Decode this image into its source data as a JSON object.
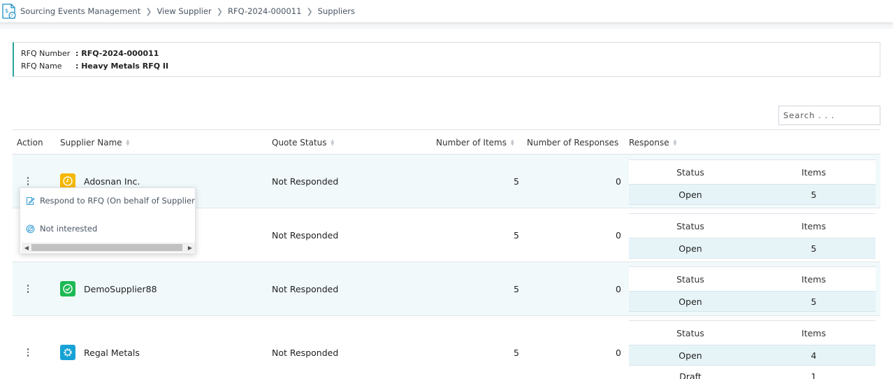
{
  "breadcrumb": [
    {
      "label": "Sourcing Events Management"
    },
    {
      "label": "View Supplier"
    },
    {
      "label": "RFQ-2024-000011"
    },
    {
      "label": "Suppliers"
    }
  ],
  "rfq": {
    "number_label": "RFQ Number",
    "number_value": ": RFQ-2024-000011",
    "name_label": "RFQ Name",
    "name_value": ": Heavy Metals RFQ II"
  },
  "search": {
    "placeholder": "Search . . ."
  },
  "table": {
    "headers": {
      "action": "Action",
      "supplier": "Supplier Name",
      "quote": "Quote Status",
      "items": "Number of Items",
      "responses": "Number of Responses",
      "response": "Response"
    },
    "resp_headers": {
      "status": "Status",
      "items": "Items"
    },
    "rows": [
      {
        "supplier": "Adosnan Inc.",
        "icon": "clock-icon",
        "icon_color": "#f5b800",
        "quote": "Not Responded",
        "items": "5",
        "responses": "0",
        "resp": [
          {
            "status": "Open",
            "items": "5"
          }
        ]
      },
      {
        "supplier": "",
        "icon": "check-icon",
        "icon_color": "#1db954",
        "quote": "Not Responded",
        "items": "5",
        "responses": "0",
        "resp": [
          {
            "status": "Open",
            "items": "5"
          }
        ]
      },
      {
        "supplier": "DemoSupplier88",
        "icon": "check-icon",
        "icon_color": "#1db954",
        "quote": "Not Responded",
        "items": "5",
        "responses": "0",
        "resp": [
          {
            "status": "Open",
            "items": "5"
          }
        ]
      },
      {
        "supplier": "Regal Metals",
        "icon": "gear-icon",
        "icon_color": "#17a2d6",
        "quote": "Not Responded",
        "items": "5",
        "responses": "0",
        "resp": [
          {
            "status": "Open",
            "items": "4"
          },
          {
            "status": "Draft",
            "items": "1"
          }
        ]
      }
    ]
  },
  "menu": {
    "respond": "Respond to RFQ (On behalf of Supplier)",
    "not_interested": "Not interested"
  },
  "colors": {
    "accent": "#2aa59a",
    "row_alt": "#f1f9fb",
    "resp_row": "#e6f4f8"
  }
}
